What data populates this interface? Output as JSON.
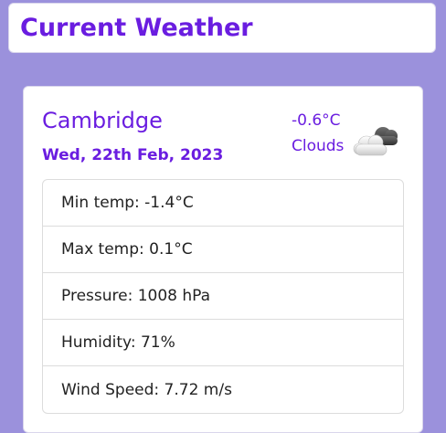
{
  "header": {
    "title": "Current Weather"
  },
  "weather": {
    "city": "Cambridge",
    "date": "Wed, 22th Feb, 2023",
    "temperature": "-0.6°C",
    "condition": "Clouds",
    "icon": "cloud-icon",
    "details": [
      "Min temp: -1.4°C",
      "Max temp: 0.1°C",
      "Pressure: 1008 hPa",
      "Humidity: 71%",
      "Wind Speed: 7.72 m/s"
    ]
  },
  "colors": {
    "background": "#9b91dc",
    "accent": "#6a1de0",
    "card": "#ffffff"
  }
}
